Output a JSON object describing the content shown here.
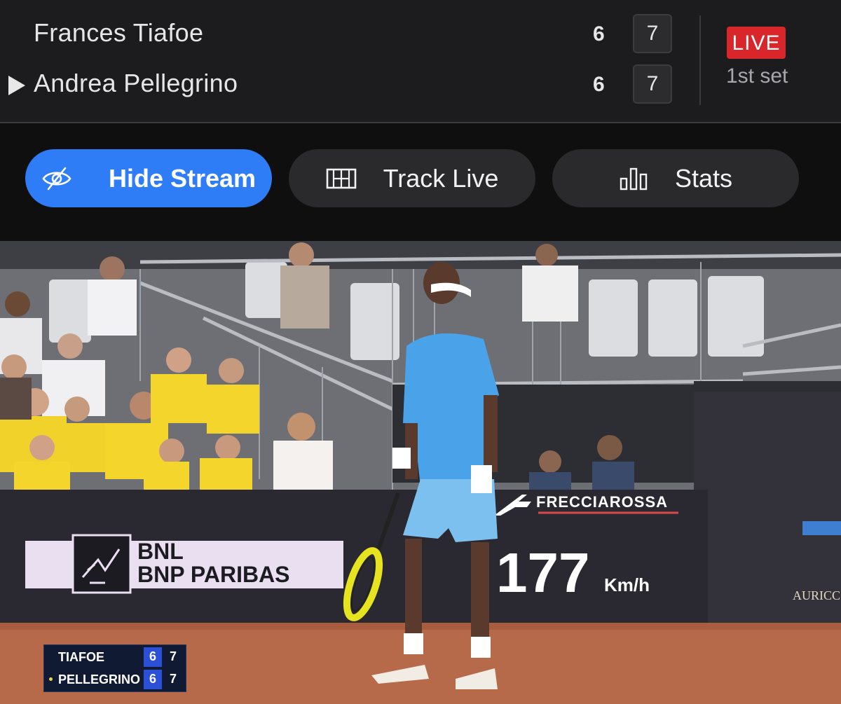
{
  "scoreboard": {
    "players": [
      {
        "name": "Frances Tiafoe",
        "sets": "6",
        "games": "7",
        "serving": false
      },
      {
        "name": "Andrea Pellegrino",
        "sets": "6",
        "games": "7",
        "serving": true
      }
    ],
    "live_label": "LIVE",
    "set_label": "1st set",
    "colors": {
      "live": "#d9262b",
      "background": "#1c1c1e"
    }
  },
  "actions": {
    "hide_stream": {
      "label": "Hide Stream",
      "icon": "eye-off-icon",
      "active": true
    },
    "track_live": {
      "label": "Track Live",
      "icon": "court-icon",
      "active": false
    },
    "stats": {
      "label": "Stats",
      "icon": "bar-chart-icon",
      "active": false
    },
    "accent_color": "#2f7df6"
  },
  "stream": {
    "sponsor_bnl_line1": "BNL",
    "sponsor_bnl_line2": "BNP PARIBAS",
    "sponsor_frecciarossa": "FRECCIAROSSA",
    "speed_value": "177",
    "speed_unit": "Km/h",
    "sponsor_auricchio": "AURICC",
    "tv_score": {
      "rows": [
        {
          "name": "TIAFOE",
          "set": "6",
          "games": "7"
        },
        {
          "name": "PELLEGRINO",
          "set": "6",
          "games": "7"
        }
      ]
    }
  }
}
